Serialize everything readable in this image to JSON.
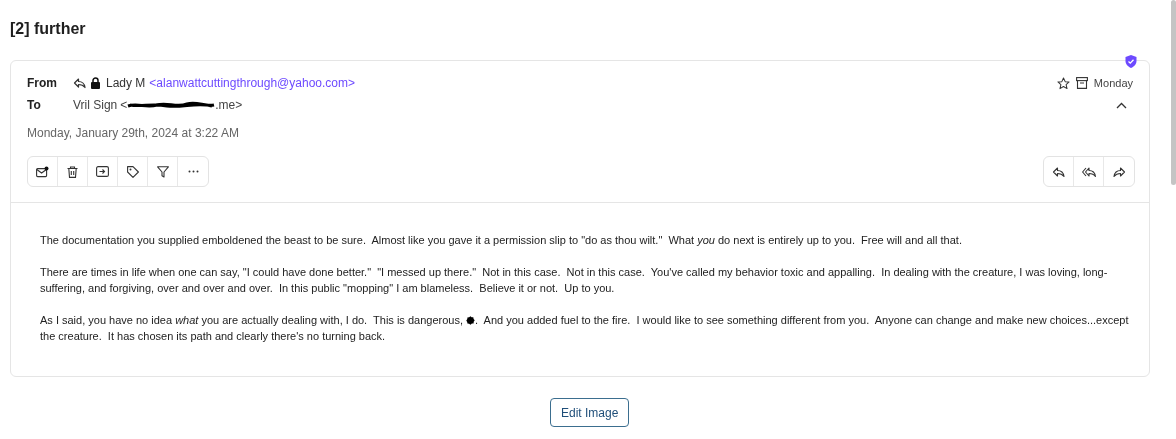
{
  "heading": "[2] further",
  "email": {
    "from": {
      "label": "From",
      "name": "Lady M",
      "address": "<alanwattcuttingthrough@yahoo.com>"
    },
    "to": {
      "label": "To",
      "name": "Vril Sign",
      "address_start": "<",
      "address_end": ".me>"
    },
    "day": "Monday",
    "date": "Monday, January 29th, 2024 at 3:22 AM",
    "body": [
      "The documentation you supplied emboldened the beast to be sure.  Almost like you gave it a permission slip to \"do as thou wilt.\"  What *you* do next is entirely up to you.  Free will and all that.",
      "There are times in life when one can say, \"I could have done better.\"  \"I messed up there.\"  Not in this case.  Not in this case.  You've called my behavior toxic and appalling.  In dealing with the creature, I was loving, long-suffering, and forgiving, over and over and over.  In this public \"mopping\" I am blameless.  Believe it or not.  Up to you.",
      [
        "As I said, you have no idea *what* you are actually dealing with, I do.  This is dangerous, ",
        ".  And you added fuel to the fire.  I would like to see something different from you.  Anyone can change and make new choices...except the creature.  It has chosen its path and clearly there's no turning back."
      ]
    ]
  },
  "edit_button": "Edit Image"
}
